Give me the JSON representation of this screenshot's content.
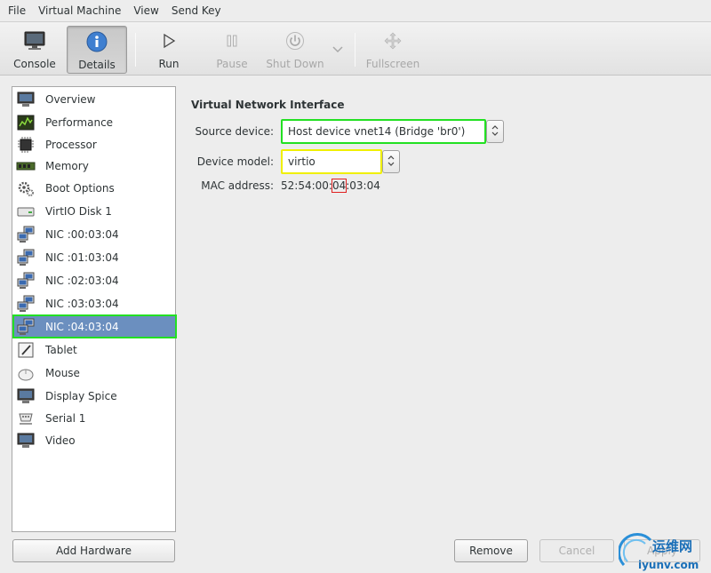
{
  "menu": [
    "File",
    "Virtual Machine",
    "View",
    "Send Key"
  ],
  "toolbar": {
    "console": "Console",
    "details": "Details",
    "run": "Run",
    "pause": "Pause",
    "shutdown": "Shut Down",
    "fullscreen": "Fullscreen"
  },
  "sidebar": {
    "items": [
      {
        "label": "Overview",
        "icon": "monitor-icon"
      },
      {
        "label": "Performance",
        "icon": "performance-graph-icon"
      },
      {
        "label": "Processor",
        "icon": "cpu-chip-icon"
      },
      {
        "label": "Memory",
        "icon": "memory-stick-icon"
      },
      {
        "label": "Boot Options",
        "icon": "gears-icon"
      },
      {
        "label": "VirtIO Disk 1",
        "icon": "disk-icon"
      },
      {
        "label": "NIC :00:03:04",
        "icon": "network-icon"
      },
      {
        "label": "NIC :01:03:04",
        "icon": "network-icon"
      },
      {
        "label": "NIC :02:03:04",
        "icon": "network-icon"
      },
      {
        "label": "NIC :03:03:04",
        "icon": "network-icon"
      },
      {
        "label": "NIC :04:03:04",
        "icon": "network-icon"
      },
      {
        "label": "Tablet",
        "icon": "tablet-icon"
      },
      {
        "label": "Mouse",
        "icon": "mouse-icon"
      },
      {
        "label": "Display Spice",
        "icon": "display-icon"
      },
      {
        "label": "Serial 1",
        "icon": "serial-port-icon"
      },
      {
        "label": "Video",
        "icon": "video-icon"
      }
    ],
    "selected_index": 10,
    "add_hardware": "Add Hardware"
  },
  "content": {
    "section_title": "Virtual Network Interface",
    "source_device_label": "Source device:",
    "source_device_value": "Host device vnet14 (Bridge 'br0')",
    "device_model_label": "Device model:",
    "device_model_value": "virtio",
    "mac_label": "MAC address:",
    "mac_prefix": "52:54:00:",
    "mac_highlight": "04",
    "mac_suffix": ":03:04"
  },
  "buttons": {
    "remove": "Remove",
    "cancel": "Cancel",
    "apply": "Apply"
  },
  "watermark": {
    "brand": "运维网",
    "url": "iyunv.com"
  },
  "colors": {
    "selection": "#6b8fbf",
    "green_highlight": "#22e022",
    "yellow_highlight": "#f0f000",
    "red_highlight": "#e02020"
  }
}
